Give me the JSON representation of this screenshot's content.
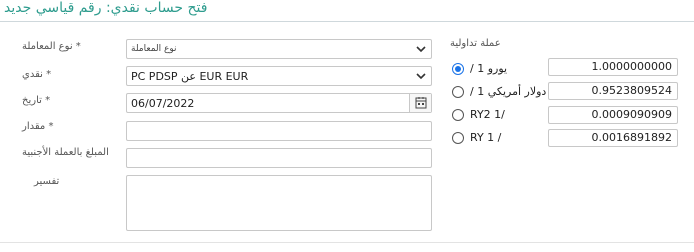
{
  "title": "فتح حساب نقدي: رقم قياسي جديد",
  "form": {
    "transaction_type": {
      "label": "* نوع المعاملة",
      "value": "نوع المعاملة"
    },
    "cash": {
      "label": "* نقدي",
      "value": "PC PDSP عن EUR EUR"
    },
    "date": {
      "label": "* تاريخ",
      "value": "06/07/2022"
    },
    "amount": {
      "label": "* مقدار",
      "value": ""
    },
    "foreign_amount": {
      "label": "المبلغ بالعملة الأجنبية",
      "value": ""
    },
    "explanation": {
      "label": "تفسير",
      "value": ""
    }
  },
  "currency": {
    "heading": "عملة تداولية",
    "options": [
      {
        "label": "/ يورو 1",
        "rate": "1.0000000000",
        "selected": true
      },
      {
        "label": "/ دولار أمريكي 1",
        "rate": "0.9523809524",
        "selected": false
      },
      {
        "label": "RY2 1/",
        "rate": "0.0009090909",
        "selected": false
      },
      {
        "label": "RY 1 /",
        "rate": "0.0016891892",
        "selected": false
      }
    ]
  },
  "icons": {
    "dropdown": "chevron-down-icon",
    "calendar": "calendar-icon"
  }
}
